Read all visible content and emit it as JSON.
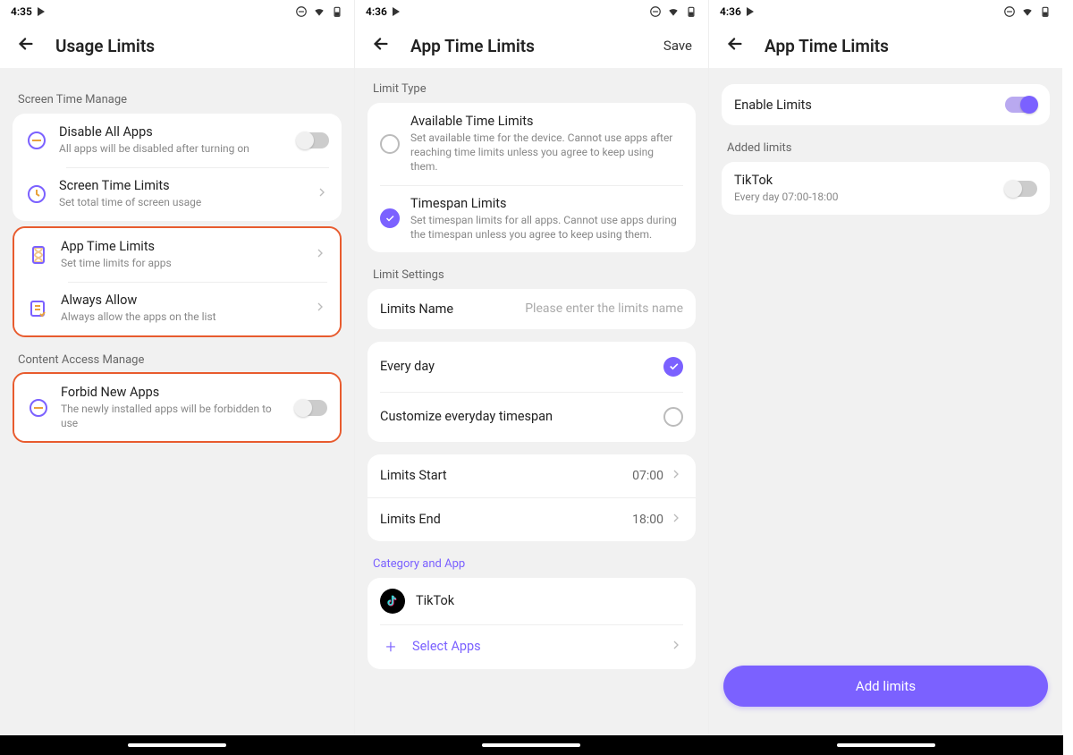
{
  "screen1": {
    "time": "4:35",
    "title": "Usage Limits",
    "section_stm": "Screen Time Manage",
    "disable_all": {
      "title": "Disable All Apps",
      "sub": "All apps will be disabled after turning on"
    },
    "stl": {
      "title": "Screen Time Limits",
      "sub": "Set total time of screen usage"
    },
    "atl": {
      "title": "App Time Limits",
      "sub": "Set time limits for apps"
    },
    "allow": {
      "title": "Always Allow",
      "sub": "Always allow the apps on the list"
    },
    "section_cam": "Content Access Manage",
    "forbid": {
      "title": "Forbid New Apps",
      "sub": "The newly installed apps will be forbidden to use"
    }
  },
  "screen2": {
    "time": "4:36",
    "title": "App Time Limits",
    "save": "Save",
    "limit_type": "Limit Type",
    "available": {
      "title": "Available Time Limits",
      "sub": "Set available time for the device. Cannot use apps after reaching time limits unless you agree to keep using them."
    },
    "timespan": {
      "title": "Timespan Limits",
      "sub": "Set timespan limits for all apps. Cannot use apps during the timespan unless you agree to keep using them."
    },
    "limit_settings": "Limit Settings",
    "limits_name_label": "Limits Name",
    "limits_name_ph": "Please enter the limits name",
    "everyday": "Every day",
    "customize": "Customize everyday timespan",
    "start_label": "Limits Start",
    "start_val": "07:00",
    "end_label": "Limits End",
    "end_val": "18:00",
    "category": "Category and App",
    "tiktok": "TikTok",
    "select_apps": "Select Apps"
  },
  "screen3": {
    "time": "4:36",
    "title": "App Time Limits",
    "enable": "Enable Limits",
    "added": "Added limits",
    "tiktok_title": "TikTok",
    "tiktok_sub": "Every day 07:00-18:00",
    "add_limits": "Add limits"
  }
}
